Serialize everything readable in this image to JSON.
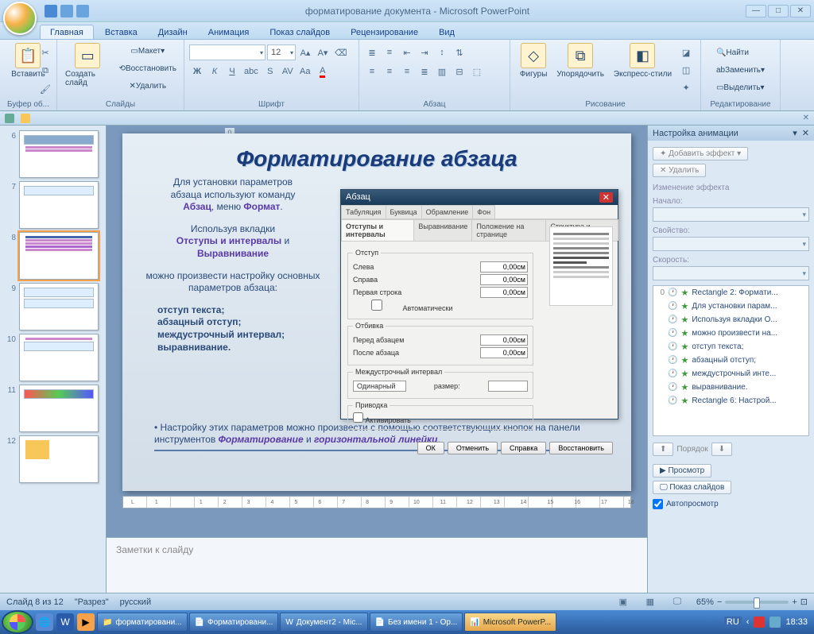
{
  "window": {
    "title": "форматирование документа - Microsoft PowerPoint"
  },
  "tabs": {
    "home": "Главная",
    "insert": "Вставка",
    "design": "Дизайн",
    "animation": "Анимация",
    "slideshow": "Показ слайдов",
    "review": "Рецензирование",
    "view": "Вид"
  },
  "ribbon": {
    "paste": "Вставить",
    "clipboard": "Буфер об...",
    "newslide": "Создать слайд",
    "layout": "Макет",
    "reset": "Восстановить",
    "delete": "Удалить",
    "slides": "Слайды",
    "font": "Шрифт",
    "fontsize": "12",
    "paragraph": "Абзац",
    "shapes": "Фигуры",
    "arrange": "Упорядочить",
    "quickstyles": "Экспресс-стили",
    "drawing": "Рисование",
    "find": "Найти",
    "replace": "Заменить",
    "select": "Выделить",
    "editing": "Редактирование"
  },
  "slidepanel": {
    "slides": [
      6,
      7,
      8,
      9,
      10,
      11,
      12
    ]
  },
  "slide": {
    "title": "Форматирование абзаца",
    "p1_a": "Для установки параметров",
    "p1_b": "абзаца используют команду",
    "p1_abzac": "Абзац",
    "p1_c": ", меню ",
    "p1_format": "Формат",
    "p1_d": ".",
    "p2_a": "Используя вкладки",
    "p2_tab1": "Отступы и интервалы",
    "p2_and": " и ",
    "p2_tab2": "Выравнивание",
    "p3": "можно произвести настройку основных параметров абзаца:",
    "li1": "отступ текста;",
    "li2": "абзацный отступ;",
    "li3": "междустрочный интервал;",
    "li4": "выравнивание.",
    "p4_a": "Настройку этих параметров можно произвести с помощью соответствующих кнопок на панели инструментов ",
    "p4_b": "Форматирование",
    "p4_c": " и ",
    "p4_d": "горизонтальной линейки",
    "p4_e": "."
  },
  "dialog": {
    "title": "Абзац",
    "tabs": {
      "indents": "Отступы и интервалы",
      "align": "Выравнивание",
      "page": "Положение на странице",
      "tabul": "Табуляция",
      "drop": "Буквица",
      "border": "Обрамление",
      "bg": "Фон",
      "struct": "Структура и нумерация"
    },
    "group_indent": "Отступ",
    "left": "Слева",
    "right": "Справа",
    "first": "Первая строка",
    "auto": "Автоматически",
    "group_spacing": "Отбивка",
    "before": "Перед абзацем",
    "after": "После абзаца",
    "group_line": "Междустрочный интервал",
    "single": "Одинарный",
    "size": "размер:",
    "group_priv": "Приводка",
    "activate": "Активировать",
    "val": "0,00см",
    "ok": "ОК",
    "cancel": "Отменить",
    "help": "Справка",
    "restore": "Восстановить"
  },
  "ruler": [
    "1",
    "",
    "1",
    "2",
    "3",
    "4",
    "5",
    "6",
    "7",
    "8",
    "9",
    "10",
    "11",
    "12",
    "13",
    "14",
    "15",
    "16",
    "17",
    "18"
  ],
  "notes": "Заметки к слайду",
  "animpane": {
    "title": "Настройка анимации",
    "add_effect": "Добавить эффект",
    "remove": "Удалить",
    "change": "Изменение эффекта",
    "start": "Начало:",
    "property": "Свойство:",
    "speed": "Скорость:",
    "items": [
      {
        "n": "0",
        "label": "Rectangle 2: Формати..."
      },
      {
        "n": "",
        "label": "Для установки парам..."
      },
      {
        "n": "",
        "label": "Используя вкладки О..."
      },
      {
        "n": "",
        "label": "можно произвести на..."
      },
      {
        "n": "",
        "label": "отступ текста;"
      },
      {
        "n": "",
        "label": "абзацный отступ;"
      },
      {
        "n": "",
        "label": "междустрочный инте..."
      },
      {
        "n": "",
        "label": "выравнивание."
      },
      {
        "n": "",
        "label": "Rectangle 6:  Настрой..."
      }
    ],
    "reorder": "Порядок",
    "preview": "Просмотр",
    "slideshow": "Показ слайдов",
    "autopreview": "Автопросмотр"
  },
  "statusbar": {
    "slide": "Слайд 8 из 12",
    "layout": "\"Разрез\"",
    "lang": "русский",
    "zoom": "65%"
  },
  "taskbar": {
    "items": [
      "форматировани...",
      "Форматировани...",
      "Документ2 - Mic...",
      "Без имени 1 - Op...",
      "Microsoft PowerP..."
    ],
    "lang": "RU",
    "time": "18:33"
  }
}
